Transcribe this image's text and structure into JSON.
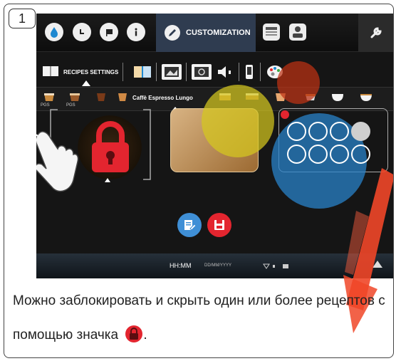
{
  "step_number": "1",
  "top_bar": {
    "tab_label": "CUSTOMIZATION",
    "icons": [
      "water-drop-icon",
      "clock-icon",
      "flag-icon",
      "info-icon",
      "pencil-icon",
      "calculator-icon",
      "person-icon",
      "wrench-icon"
    ]
  },
  "settings_row": {
    "label": "RECIPES SETTINGS",
    "icons": [
      "book-icon",
      "image-icon",
      "display-icon",
      "speaker-icon",
      "phone-icon",
      "palette-icon"
    ]
  },
  "recipe_strip": {
    "selected_recipe": "Caffè Espresso Lungo",
    "pgs_labels": [
      "PGS",
      "PGS"
    ]
  },
  "status_bar": {
    "time": "HH:MM",
    "date": "DD/MM/YYYY"
  },
  "caption": {
    "text": "Можно заблокировать и скрыть один или более рецептов с помощью значка",
    "end": "."
  },
  "colors": {
    "lock_red": "#e3252f",
    "highlight_yellow": "#d6c81e",
    "highlight_blue": "#2882c8",
    "tab_blue": "#2f3c50",
    "edit_blue": "#3f8fd6"
  }
}
